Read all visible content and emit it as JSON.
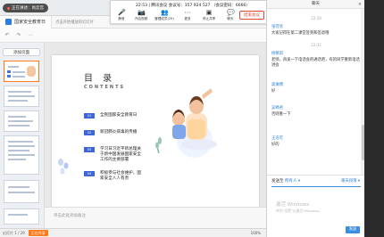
{
  "recording": {
    "label": "正在讲述：尚云宫"
  },
  "doc": {
    "tab_title": "国家安全教育日",
    "hint": "点击开始播放的幻灯片"
  },
  "toolbar": {
    "undo": "↶",
    "redo": "↷",
    "more": "⋯"
  },
  "sidebar": {
    "add_slide": "添加页面",
    "thumb_numbers": [
      "1",
      "2",
      "3",
      "4",
      "5"
    ]
  },
  "slide": {
    "title": "目  录",
    "subtitle": "CONTENTS",
    "items": [
      {
        "num": "01",
        "text": "全民国家安全教育日"
      },
      {
        "num": "02",
        "text": "新冠肺炎病毒的传播"
      },
      {
        "num": "03",
        "text": "学习日习近平新总理关于新中国发展国家安全工作的主要部署"
      },
      {
        "num": "04",
        "text": "积极参与社会维护，国家安全人人有责"
      }
    ]
  },
  "notes": {
    "placeholder": "单击此处添加备注"
  },
  "status": {
    "slide_info": "幻灯片 1 / 29",
    "badge": "正在共享",
    "zoom": "100%"
  },
  "meeting": {
    "time": "22:53",
    "meeting_id": "腾讯会议 会议号：357 924 527 （会议密码：6666）",
    "buttons": [
      {
        "label": "静音",
        "icon": "🎤"
      },
      {
        "label": "开启视频",
        "icon": "📷"
      },
      {
        "label": "管理成员(29)",
        "icon": "👥"
      },
      {
        "label": "更多",
        "icon": "⋯"
      },
      {
        "label": "停止共享",
        "icon": "▣"
      },
      {
        "label": "聊天",
        "icon": "💬"
      }
    ],
    "end_button": "结束会议"
  },
  "chat": {
    "header": "聊天",
    "messages": [
      {
        "time": "22:28",
        "sender": "张可欣",
        "body": "大家记得在第二课堂签到和签退哦"
      },
      {
        "time": "22:32",
        "sender": "杨佩琪",
        "body": "老师，再发一下电话会的通话吧，有的同学重新电话进会"
      },
      {
        "time": "",
        "sender": "高澜博",
        "body": "好"
      },
      {
        "time": "",
        "sender": "吴婷君",
        "body": "否则重一下"
      },
      {
        "time": "",
        "sender": "王浩可",
        "body": "好的"
      }
    ],
    "send_to_label": "发送至",
    "send_to_target": "所有人 ▾",
    "permission": "聊天权限 ▾",
    "watermark": "激活 Windows",
    "watermark_sub": "转到\"设置\"以激活 Windows。",
    "send_button": "发送"
  },
  "colors": {
    "accent": "#3d66d6",
    "orange": "#ff7a1a",
    "chat_blue": "#2b7bd8"
  }
}
